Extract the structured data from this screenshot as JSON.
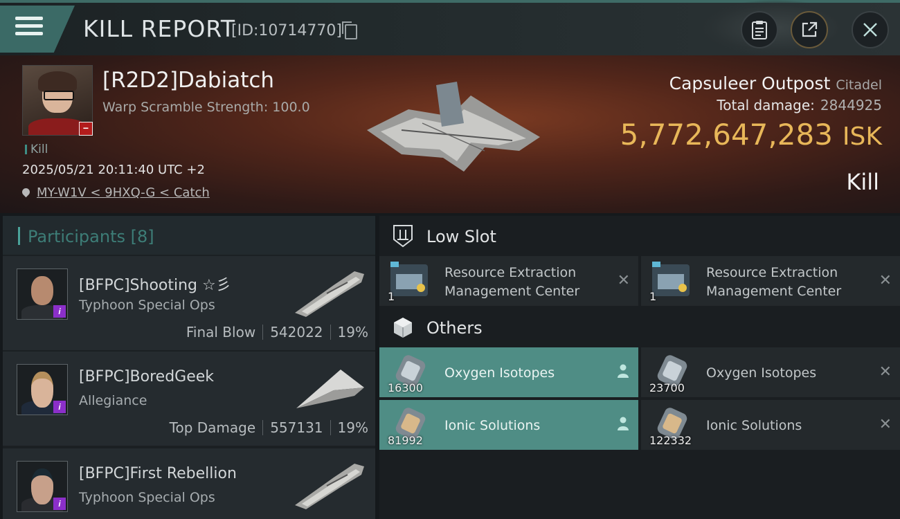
{
  "header": {
    "title": "KILL REPORT",
    "report_id": "[ID:10714770]"
  },
  "victim": {
    "name": "[R2D2]Dabiatch",
    "warp_scramble": "Warp Scramble Strength: 100.0",
    "tag": "Kill",
    "timestamp": "2025/05/21 20:11:40 UTC +2",
    "location": "MY-W1V < 9HXQ-G < Catch",
    "structure_name": "Capsuleer Outpost",
    "structure_type": "Citadel",
    "total_damage_label": "Total damage:",
    "total_damage_value": "2844925",
    "isk_value": "5,772,647,283",
    "isk_unit": "ISK",
    "result": "Kill"
  },
  "participants": {
    "title": "Participants [8]",
    "rows": [
      {
        "name": "[BFPC]Shooting ☆彡",
        "ship": "Typhoon Special Ops",
        "role": "Final Blow",
        "damage": "542022",
        "pct": "19%"
      },
      {
        "name": "[BFPC]BoredGeek",
        "ship": "Allegiance",
        "role": "Top Damage",
        "damage": "557131",
        "pct": "19%"
      },
      {
        "name": "[BFPC]First Rebellion",
        "ship": "Typhoon Special Ops",
        "role": "",
        "damage": "",
        "pct": ""
      }
    ]
  },
  "low_slot": {
    "title": "Low Slot",
    "items": [
      {
        "name_line1": "Resource Extraction",
        "name_line2": "Management Center",
        "qty": "1"
      },
      {
        "name_line1": "Resource Extraction",
        "name_line2": "Management Center",
        "qty": "1"
      }
    ]
  },
  "others": {
    "title": "Others",
    "items": [
      {
        "name": "Oxygen Isotopes",
        "qty": "16300",
        "highlight": true
      },
      {
        "name": "Oxygen Isotopes",
        "qty": "23700",
        "highlight": false
      },
      {
        "name": "Ionic Solutions",
        "qty": "81992",
        "highlight": true
      },
      {
        "name": "Ionic Solutions",
        "qty": "122332",
        "highlight": false
      }
    ]
  },
  "colors": {
    "accent": "#3b6a66",
    "isk": "#e8b759",
    "highlight_row": "#4f8d85",
    "badge": "#8b2fc9"
  }
}
